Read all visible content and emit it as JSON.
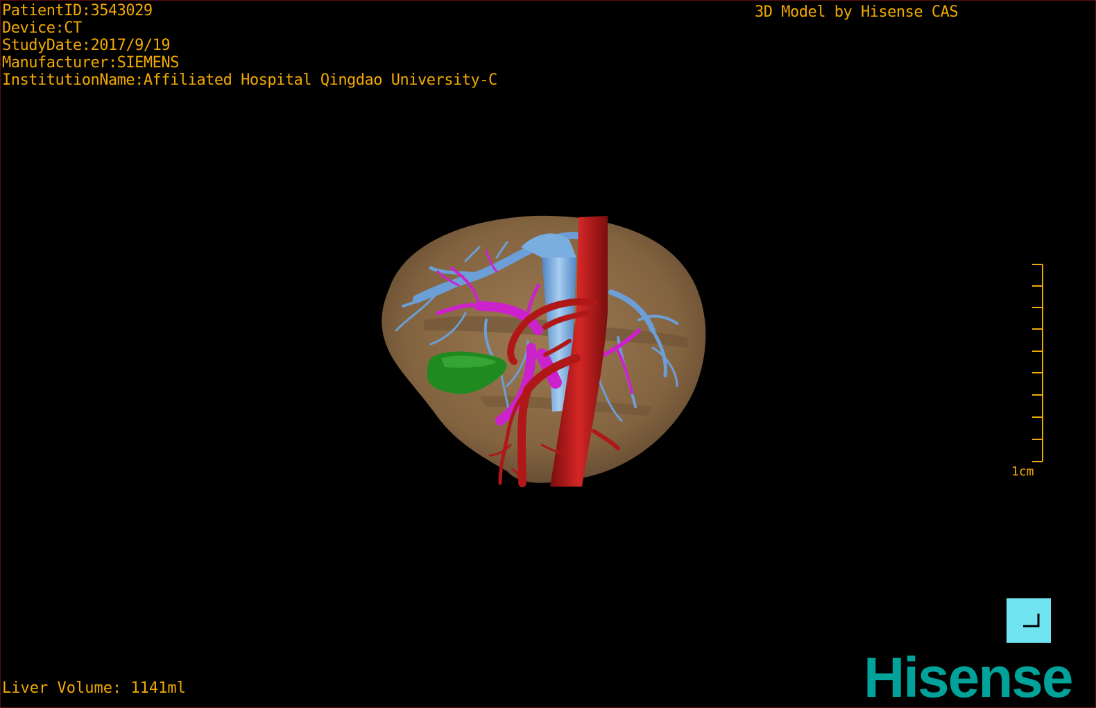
{
  "window": {
    "title": "3D Model by Hisense CAS"
  },
  "patient_info": {
    "patient_id": "PatientID:3543029",
    "device": "Device:CT",
    "study_date": "StudyDate:2017/9/19",
    "manufacturer": "Manufacturer:SIEMENS",
    "institution": "InstitutionName:Affiliated Hospital Qingdao University-C"
  },
  "measurements": {
    "liver_volume": "Liver Volume: 1141ml"
  },
  "scale": {
    "label": "1cm",
    "ticks": 10
  },
  "brand": {
    "logo_text": "Hisense",
    "color": "#00a29a"
  },
  "colors": {
    "text": "#f2a900",
    "liver": "#8a6a45",
    "portal_vein": "#6c9fd8",
    "hepatic_vein": "#cc22cc",
    "artery": "#b01818",
    "gallbladder": "#1f8a1f",
    "corner_button": "#6fe3f0"
  },
  "icons": {
    "corner_button": "corner-bracket-icon"
  }
}
